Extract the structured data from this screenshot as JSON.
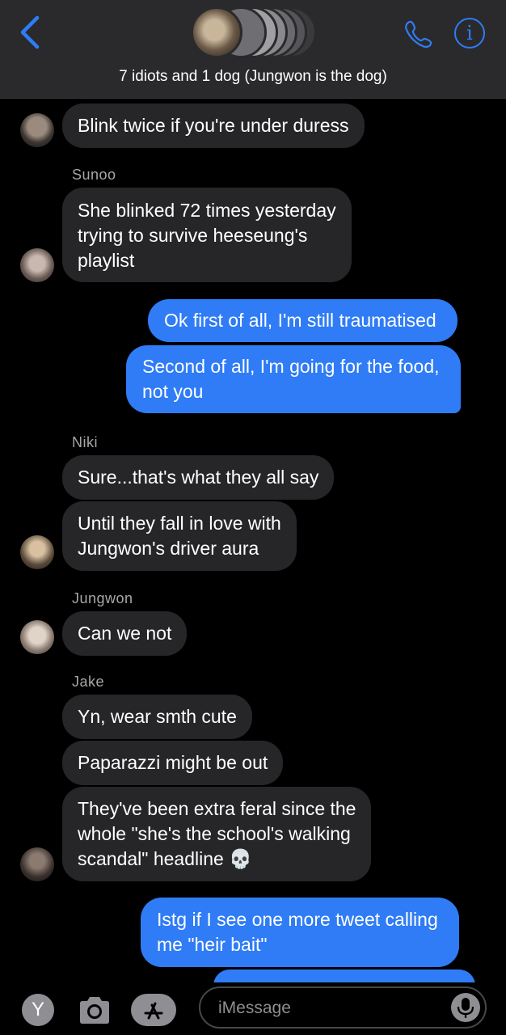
{
  "header": {
    "title": "7 idiots and 1 dog (Jungwon is the dog)"
  },
  "messages": [
    {
      "type": "in",
      "text": "Blink twice if you're under duress"
    },
    {
      "sender": "Sunoo"
    },
    {
      "type": "in",
      "text": "She blinked 72 times yesterday\ntrying to survive heeseung's\nplaylist"
    },
    {
      "type": "out",
      "text": "Ok first of all, I'm still traumatised"
    },
    {
      "type": "out",
      "text": "Second of all, I'm going for the food,\nnot you"
    },
    {
      "sender": "Niki"
    },
    {
      "type": "in",
      "text": "Sure...that's what they all say"
    },
    {
      "type": "in",
      "text": "Until they fall in love with\nJungwon's driver aura"
    },
    {
      "sender": "Jungwon"
    },
    {
      "type": "in",
      "text": "Can we not"
    },
    {
      "sender": "Jake"
    },
    {
      "type": "in",
      "text": "Yn, wear smth cute"
    },
    {
      "type": "in",
      "text": "Paparazzi might be out"
    },
    {
      "type": "in",
      "text": "They've been extra feral since the\nwhole \"she's the school's walking\nscandal\" headline 💀"
    },
    {
      "type": "out",
      "text": "Istg if I see one more tweet calling\nme \"heir bait\""
    }
  ],
  "senders": {
    "sunoo": "Sunoo",
    "niki": "Niki",
    "jungwon": "Jungwon",
    "jake": "Jake"
  },
  "bottom_bar": {
    "y_app_label": "Y",
    "input_placeholder": "iMessage"
  },
  "colors": {
    "accent": "#2f7cf6",
    "incoming_bubble": "#262628",
    "header_bg": "#2a2a2c",
    "background": "#000000"
  },
  "icons": [
    "back-chevron-icon",
    "phone-icon",
    "info-icon",
    "camera-icon",
    "app-store-icon",
    "microphone-icon"
  ]
}
